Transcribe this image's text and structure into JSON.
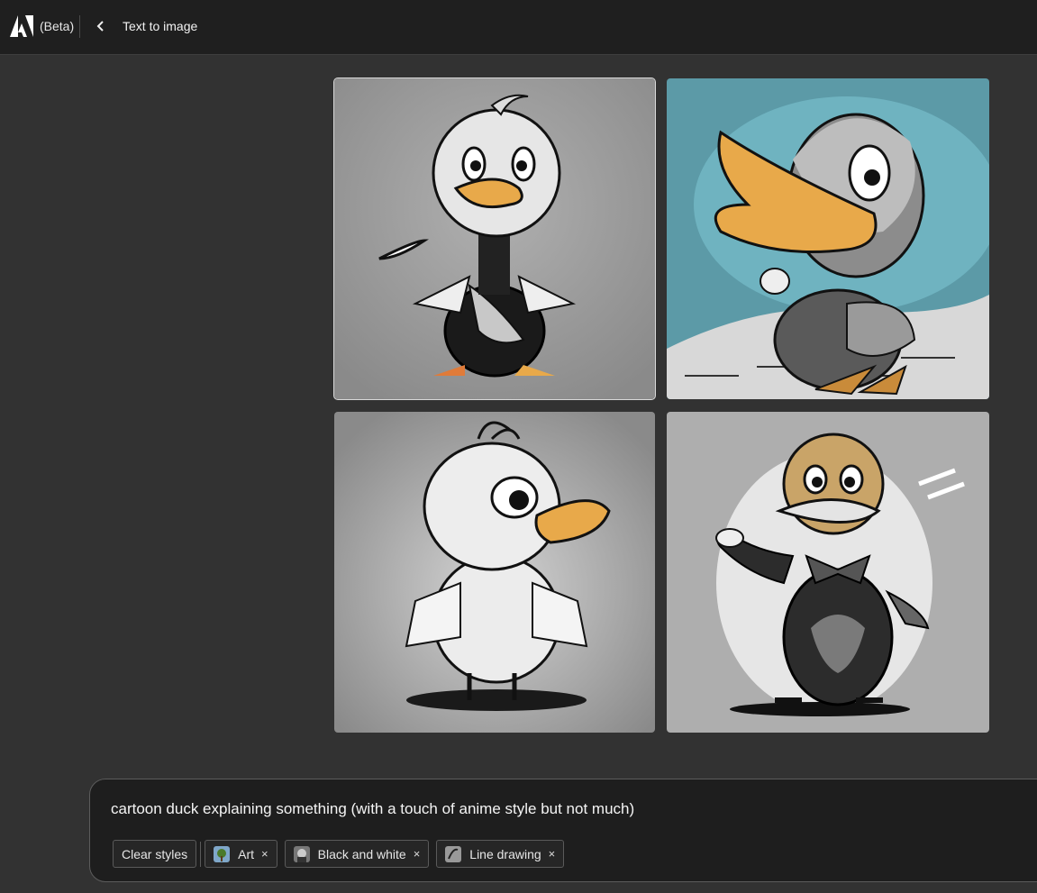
{
  "header": {
    "beta_label": "(Beta)",
    "page_title": "Text to image",
    "logo_icon": "adobe-logo",
    "back_icon": "chevron-left-icon"
  },
  "gallery": {
    "images": [
      {
        "style": "grayscale duck, orange beak and feet"
      },
      {
        "style": "gray duck on teal background, orange beak"
      },
      {
        "style": "white duckling, orange beak, gray background"
      },
      {
        "style": "tan-headed duck with bow tie, gray background"
      }
    ]
  },
  "prompt": {
    "text": "cartoon duck explaining something (with a touch of anime style but not much)",
    "clear_styles_label": "Clear styles",
    "chips": [
      {
        "label": "Art",
        "remove_label": "×"
      },
      {
        "label": "Black and white",
        "remove_label": "×"
      },
      {
        "label": "Line drawing",
        "remove_label": "×"
      }
    ]
  },
  "colors": {
    "background": "#323232",
    "topbar": "#1f1f1f",
    "panel": "#1e1e1e",
    "duck_orange": "#e8a94a"
  }
}
